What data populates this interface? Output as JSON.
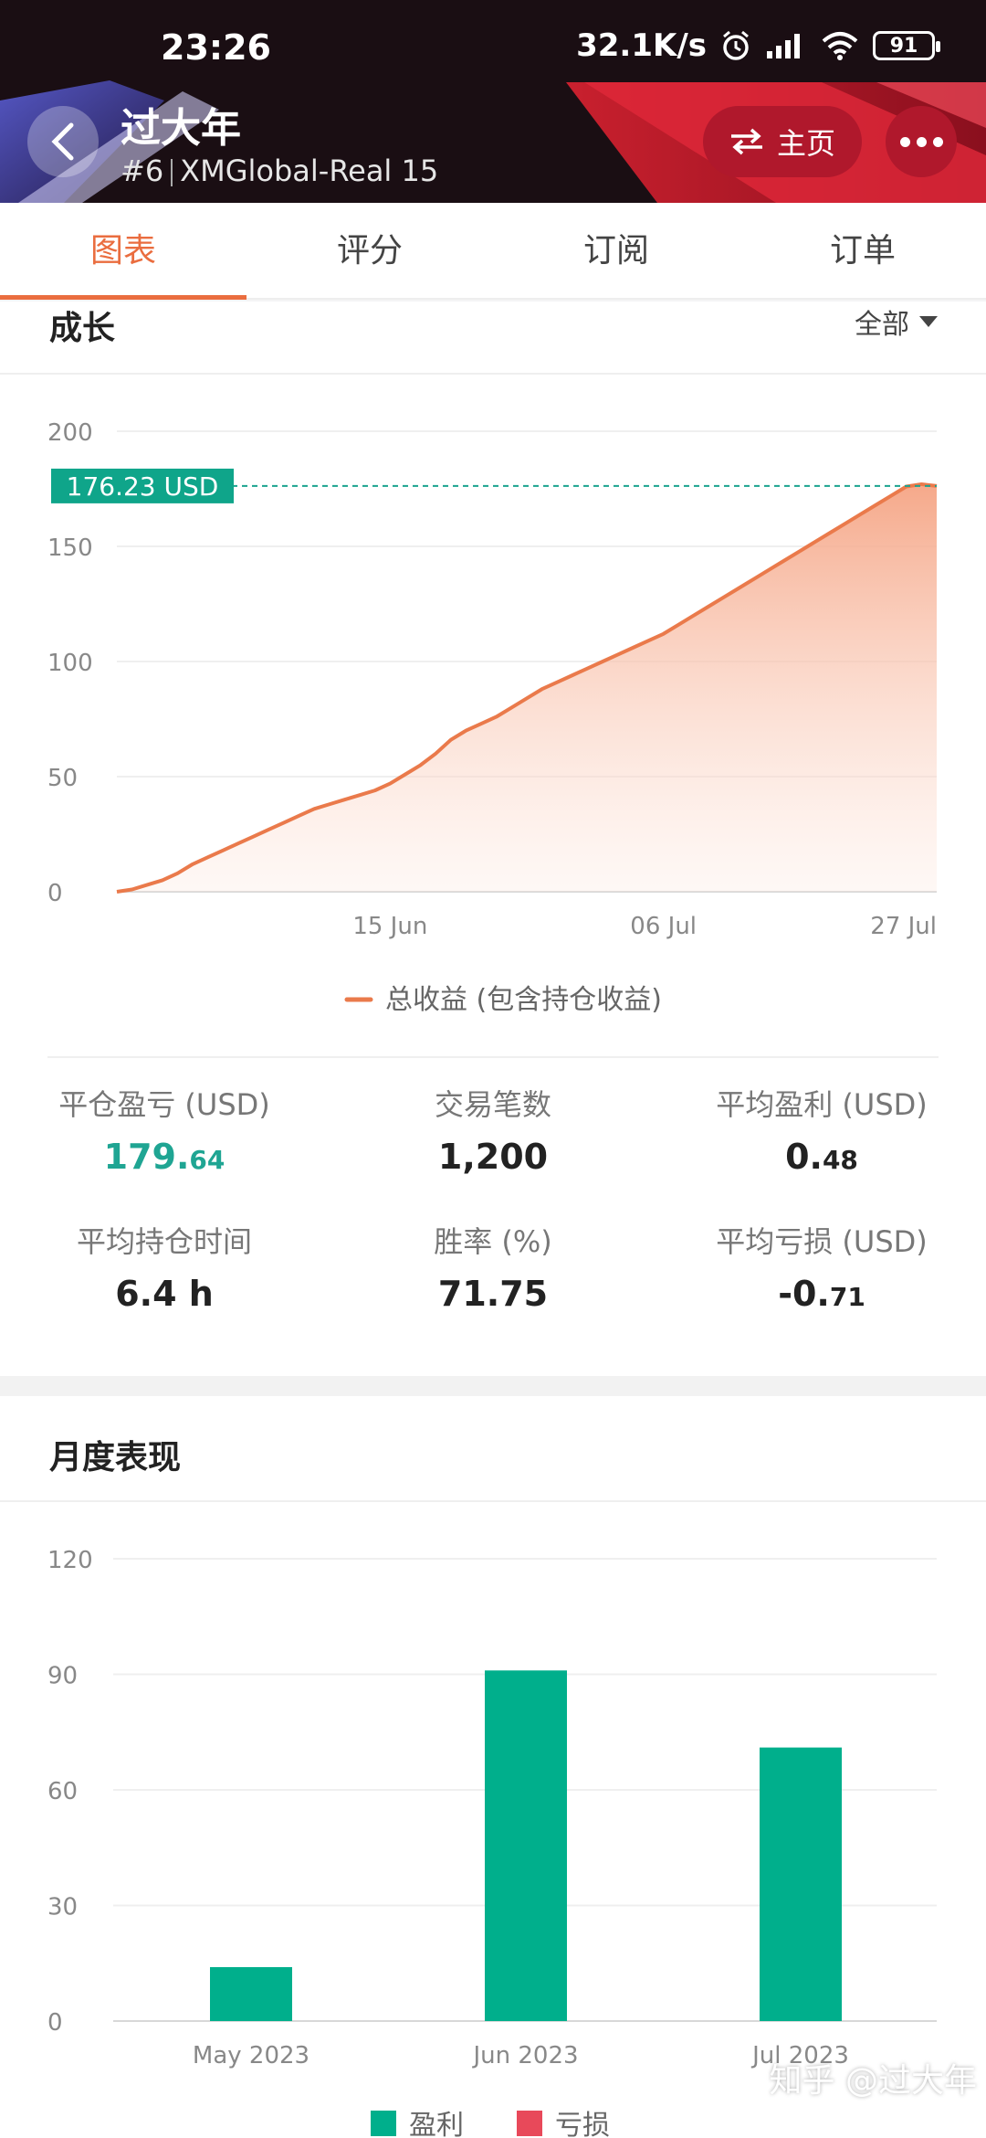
{
  "status_bar": {
    "time": "23:26",
    "speed": "32.1K/s",
    "battery": "91"
  },
  "header": {
    "title": "过大年",
    "rank": "#6",
    "account": "XMGlobal-Real 15",
    "home_label": "主页"
  },
  "tabs": [
    {
      "label": "图表",
      "active": true
    },
    {
      "label": "评分",
      "active": false
    },
    {
      "label": "订阅",
      "active": false
    },
    {
      "label": "订单",
      "active": false
    }
  ],
  "growth": {
    "title": "成长",
    "filter": "全部",
    "current_label": "176.23 USD",
    "legend": "总收益 (包含持仓收益)"
  },
  "stats": [
    {
      "label": "平仓盈亏 (USD)",
      "value_main": "179.",
      "value_small": "64",
      "color": "#1fa593"
    },
    {
      "label": "交易笔数",
      "value_main": "1,200",
      "value_small": ""
    },
    {
      "label": "平均盈利 (USD)",
      "value_main": "0.",
      "value_small": "48"
    },
    {
      "label": "平均持仓时间",
      "value_main": "6.4 h",
      "value_small": ""
    },
    {
      "label": "胜率 (%)",
      "value_main": "71.75",
      "value_small": ""
    },
    {
      "label": "平均亏损 (USD)",
      "value_main": "-0.",
      "value_small": "71"
    }
  ],
  "monthly": {
    "title": "月度表现",
    "legend_profit": "盈利",
    "legend_loss": "亏损"
  },
  "watermark": "知乎 @过大年",
  "chart_data": [
    {
      "type": "area",
      "title": "成长",
      "ylim": [
        0,
        200
      ],
      "yticks": [
        0,
        50,
        100,
        150,
        200
      ],
      "x_tick_labels": [
        "15 Jun",
        "06 Jul",
        "27 Jul"
      ],
      "x_tick_index": [
        60,
        120,
        180
      ],
      "series": [
        {
          "name": "总收益 (包含持仓收益)",
          "color": "#ea7a4b",
          "values": [
            0,
            1,
            3,
            5,
            8,
            12,
            15,
            18,
            21,
            24,
            27,
            30,
            33,
            36,
            38,
            40,
            42,
            44,
            47,
            51,
            55,
            60,
            66,
            70,
            73,
            76,
            80,
            84,
            88,
            91,
            94,
            97,
            100,
            103,
            106,
            109,
            112,
            116,
            120,
            124,
            128,
            132,
            136,
            140,
            144,
            148,
            152,
            156,
            160,
            164,
            168,
            172,
            176,
            177,
            176.23
          ]
        }
      ],
      "reference_value": 176.23
    },
    {
      "type": "bar",
      "title": "月度表现",
      "categories": [
        "May 2023",
        "Jun 2023",
        "Jul 2023"
      ],
      "ylim": [
        0,
        120
      ],
      "yticks": [
        0,
        30,
        60,
        90,
        120
      ],
      "series": [
        {
          "name": "盈利",
          "color": "#00af8c",
          "values": [
            14,
            91,
            71
          ]
        },
        {
          "name": "亏损",
          "color": "#e8495a",
          "values": [
            0,
            0,
            0
          ]
        }
      ]
    }
  ]
}
